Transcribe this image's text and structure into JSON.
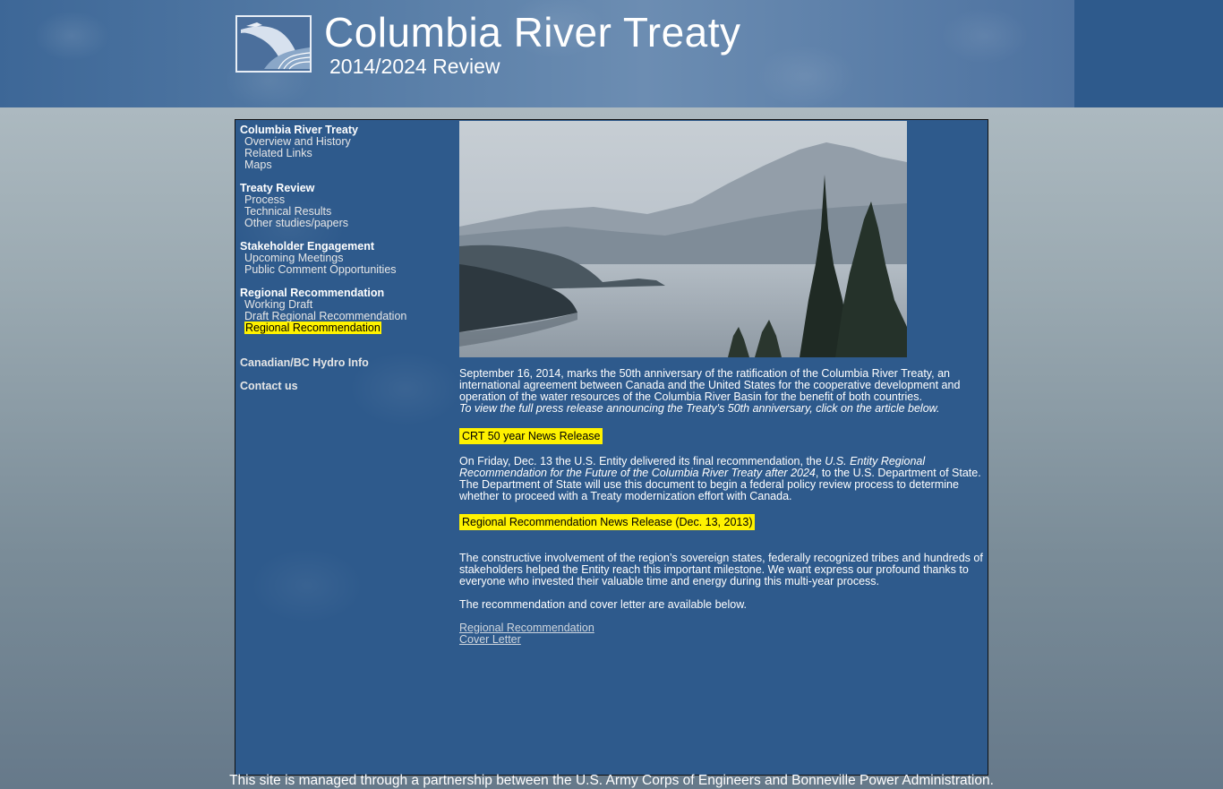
{
  "header": {
    "title": "Columbia River Treaty",
    "subtitle": "2014/2024 Review",
    "logo_icon": "river-dam-logo-icon"
  },
  "sidebar": {
    "groups": [
      {
        "heading": "Columbia River Treaty",
        "links": [
          "Overview and History",
          "Related Links",
          "Maps"
        ]
      },
      {
        "heading": "Treaty Review",
        "links": [
          "Process",
          "Technical Results",
          "Other studies/papers"
        ]
      },
      {
        "heading": "Stakeholder Engagement",
        "links": [
          "Upcoming Meetings",
          "Public Comment Opportunities"
        ]
      },
      {
        "heading": "Regional Recommendation",
        "links": [
          "Working Draft",
          "Draft Regional Recommendation",
          "Regional Recommendation"
        ]
      }
    ],
    "extra_links": [
      "Canadian/BC Hydro Info",
      "Contact us"
    ]
  },
  "hero": {
    "description_icon": "lake-mountain-photo"
  },
  "content": {
    "para1": "September 16, 2014, marks the 50th anniversary of the ratification of the Columbia River Treaty, an international agreement between Canada and the United States for the cooperative development and operation of the water resources of the Columbia River Basin for the benefit of both countries.",
    "para1_italic": "To view the full press release announcing the Treaty's 50th anniversary, click on the article below.",
    "button1": "CRT 50 year News Release",
    "para2_a": "On Friday, Dec. 13 the U.S. Entity delivered its final recommendation, the ",
    "para2_italic": "U.S. Entity Regional Recommendation for the Future of the Columbia River Treaty after 2024",
    "para2_b": ", to the U.S. Department of State. The Department of State will use this document to begin a federal policy review process to determine whether to proceed with a Treaty modernization effort with Canada.",
    "button2": "Regional Recommendation News Release (Dec. 13, 2013)",
    "para3": "The constructive involvement of the region’s sovereign states, federally recognized tribes and hundreds of stakeholders helped the Entity reach this important milestone. We want express our profound thanks to everyone who invested their valuable time and energy during this multi-year process.",
    "para4": "The recommendation and cover letter are available below.",
    "doc_links": [
      "Regional Recommendation",
      "Cover Letter"
    ]
  },
  "footer": {
    "text": "This site is managed through a partnership between the U.S. Army Corps of Engineers and Bonneville Power Administration."
  },
  "colors": {
    "accent_blue": "#2e5a8c",
    "highlight_yellow": "#fff200"
  }
}
